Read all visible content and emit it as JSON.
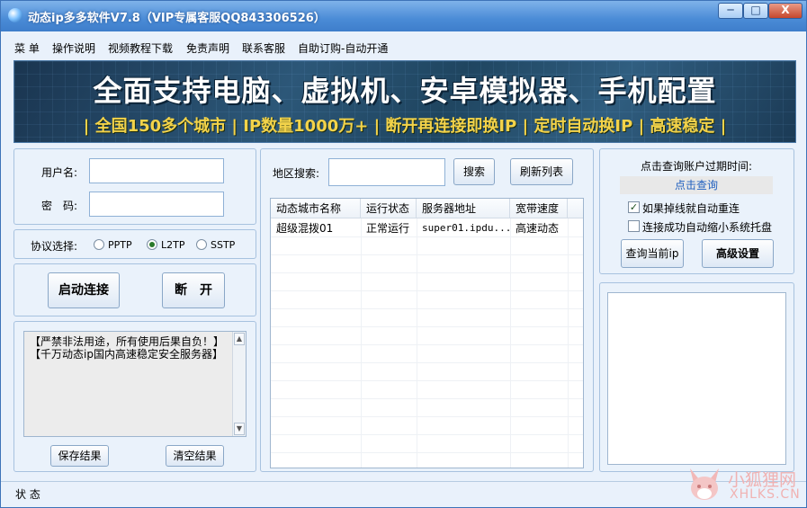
{
  "window": {
    "title": "动态ip多多软件V7.8（VIP专属客服QQ843306526）",
    "controls": {
      "minimize": "─",
      "maximize": "□",
      "close": "X"
    }
  },
  "menu": [
    "菜 单",
    "操作说明",
    "视频教程下载",
    "免责声明",
    "联系客服",
    "自助订购-自动开通"
  ],
  "banner": {
    "line1": "全面支持电脑、虚拟机、安卓模拟器、手机配置",
    "line2": "| 全国150多个城市 | IP数量1000万+ | 断开再连接即换IP | 定时自动换IP | 高速稳定 |"
  },
  "login": {
    "username_label": "用户名:",
    "password_label": "密　码:",
    "username_value": "",
    "password_value": ""
  },
  "protocol": {
    "label": "协议选择:",
    "options": [
      {
        "label": "PPTP",
        "checked": false
      },
      {
        "label": "L2TP",
        "checked": true
      },
      {
        "label": "SSTP",
        "checked": false
      }
    ]
  },
  "actions": {
    "connect": "启动连接",
    "disconnect": "断　开"
  },
  "log": {
    "lines": [
      "【严禁非法用途，所有使用后果自负！】",
      "【千万动态ip国内高速稳定安全服务器】"
    ],
    "save": "保存结果",
    "clear": "清空结果"
  },
  "region": {
    "label": "地区搜索:",
    "value": "",
    "search": "搜索",
    "refresh": "刷新列表"
  },
  "server_table": {
    "columns": [
      "动态城市名称",
      "运行状态",
      "服务器地址",
      "宽带速度"
    ],
    "rows": [
      [
        "超级混拨01",
        "正常运行",
        "super01.ipdu...",
        "高速动态"
      ]
    ]
  },
  "account": {
    "expiry_label": "点击查询账户过期时间:",
    "query_link": "点击查询",
    "options": [
      {
        "label": "如果掉线就自动重连",
        "checked": true
      },
      {
        "label": "连接成功自动缩小系统托盘",
        "checked": false
      }
    ],
    "query_ip": "查询当前ip",
    "advanced": "高级设置"
  },
  "status": {
    "label": "状 态"
  },
  "watermark": {
    "line1": "小狐狸网",
    "line2": "XHLKS.CN"
  }
}
